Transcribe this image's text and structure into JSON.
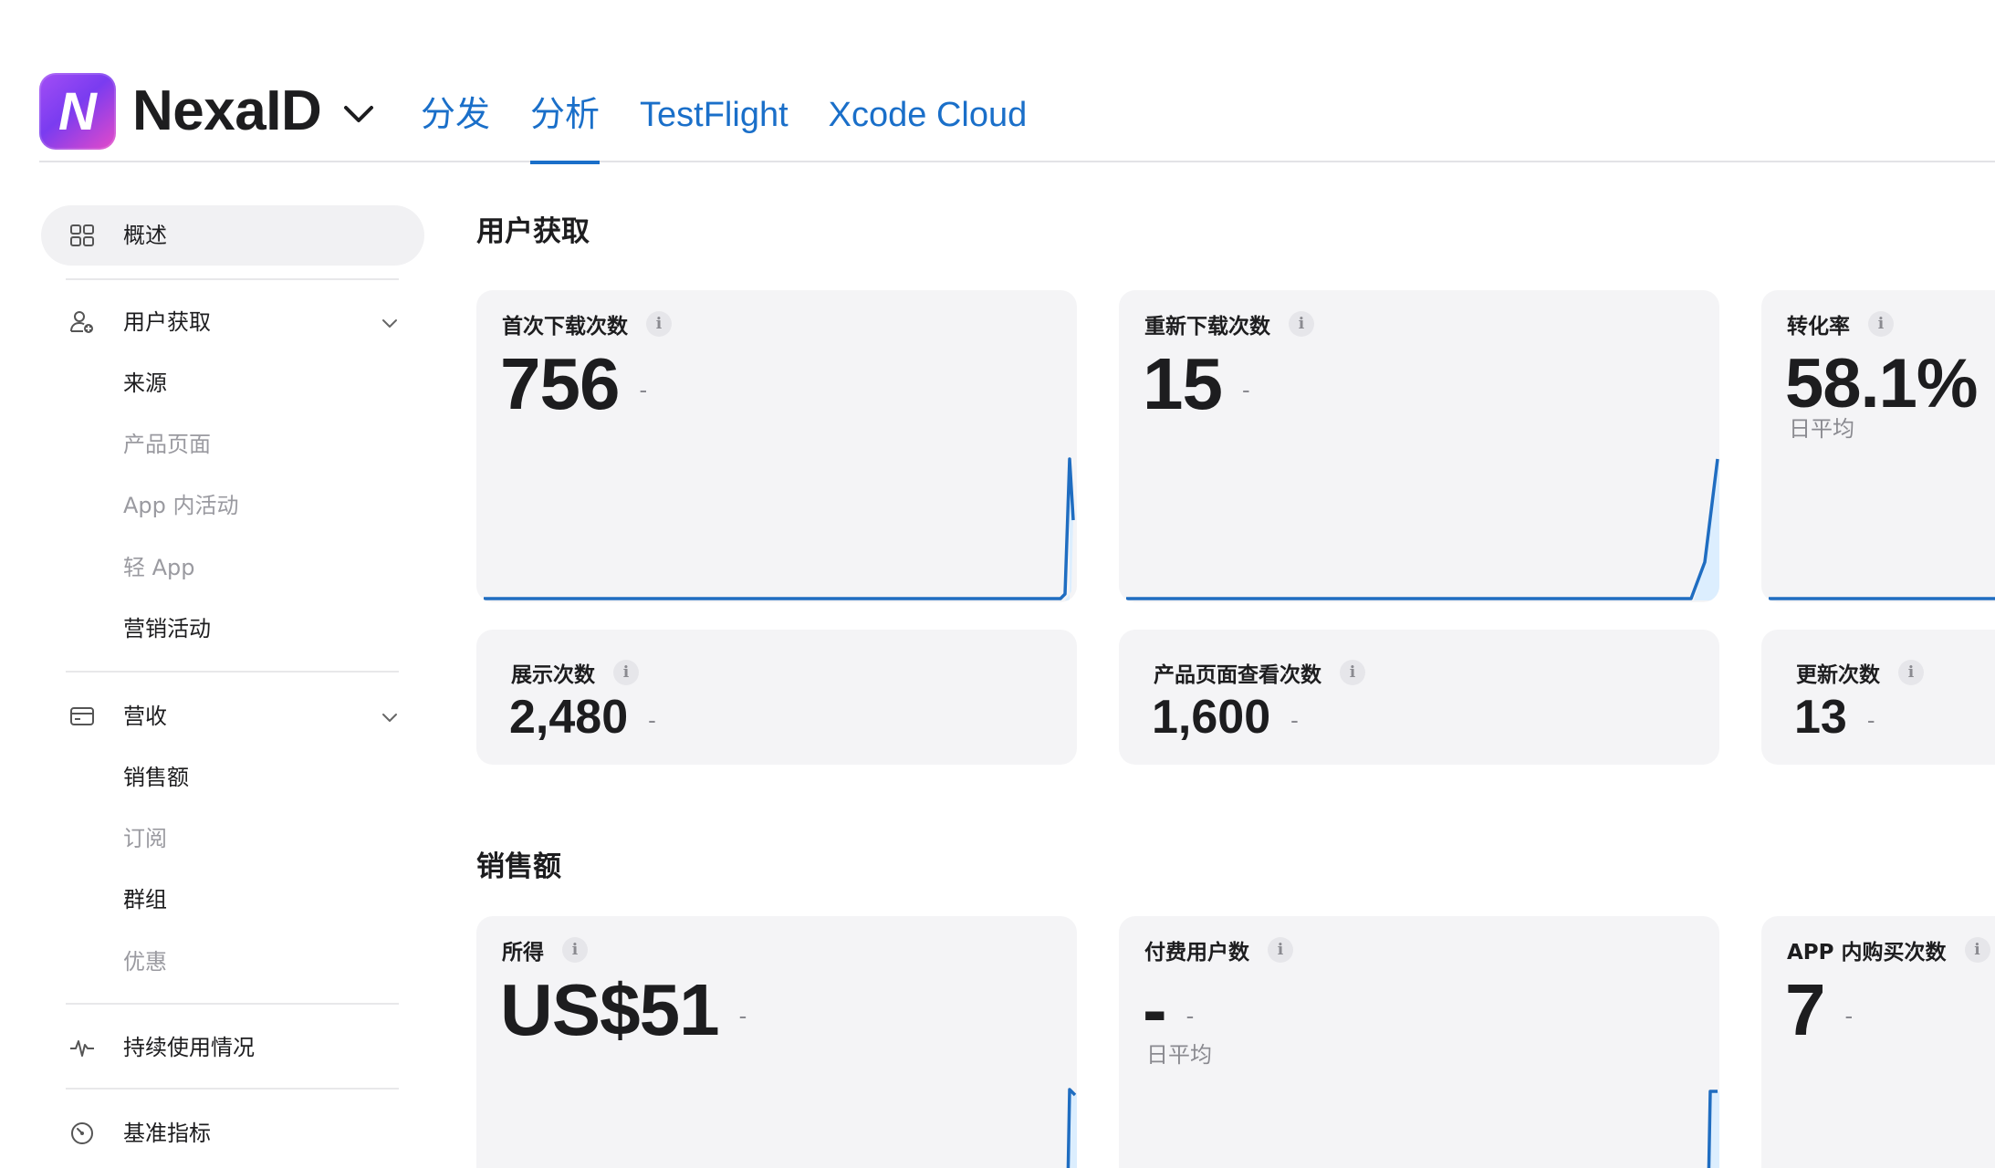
{
  "header": {
    "app_name": "NexaID",
    "logo_letter": "N",
    "tabs": [
      {
        "label": "分发"
      },
      {
        "label": "分析",
        "active": true
      },
      {
        "label": "TestFlight"
      },
      {
        "label": "Xcode Cloud"
      }
    ]
  },
  "sidebar": {
    "overview": "概述",
    "acquisition": {
      "label": "用户获取",
      "items": [
        {
          "label": "来源",
          "dim": false
        },
        {
          "label": "产品页面",
          "dim": true
        },
        {
          "label": "App 内活动",
          "dim": true
        },
        {
          "label": "轻 App",
          "dim": true
        },
        {
          "label": "营销活动",
          "dim": false
        }
      ]
    },
    "revenue": {
      "label": "营收",
      "items": [
        {
          "label": "销售额",
          "dim": false
        },
        {
          "label": "订阅",
          "dim": true
        },
        {
          "label": "群组",
          "dim": false
        },
        {
          "label": "优惠",
          "dim": true
        }
      ]
    },
    "usage": "持续使用情况",
    "benchmarks": "基准指标"
  },
  "acquisition_section": {
    "title": "用户获取",
    "cards": [
      {
        "title": "首次下载次数",
        "value": "756",
        "trend": "-"
      },
      {
        "title": "重新下载次数",
        "value": "15",
        "trend": "-"
      },
      {
        "title": "转化率",
        "value": "58.1%",
        "caption": "日平均"
      }
    ],
    "small_cards": [
      {
        "title": "展示次数",
        "value": "2,480",
        "trend": "-"
      },
      {
        "title": "产品页面查看次数",
        "value": "1,600",
        "trend": "-"
      },
      {
        "title": "更新次数",
        "value": "13",
        "trend": "-"
      }
    ]
  },
  "sales_section": {
    "title": "销售额",
    "cards": [
      {
        "title": "所得",
        "value": "US$51",
        "trend": "-"
      },
      {
        "title": "付费用户数",
        "value": "-",
        "trend": "-",
        "caption": "日平均"
      },
      {
        "title": "APP 内购买次数",
        "value": "7",
        "trend": "-"
      }
    ]
  },
  "info_glyph": "i",
  "colors": {
    "accent": "#1a6fc9",
    "card_bg": "#f4f4f6",
    "muted_text": "#8a8a90"
  }
}
